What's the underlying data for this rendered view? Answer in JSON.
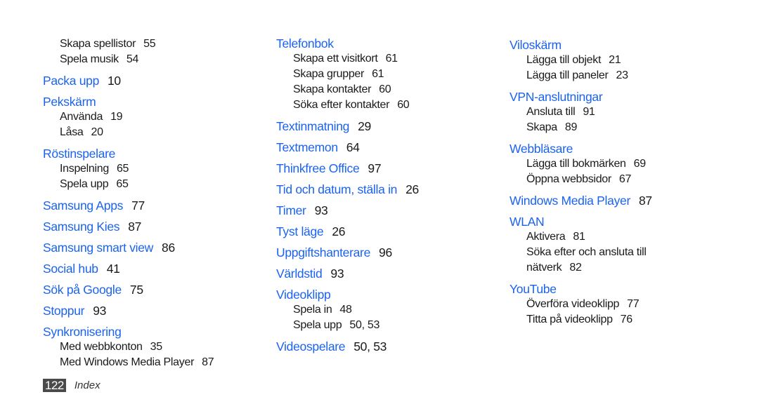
{
  "colors": {
    "heading": "#1b63ef",
    "text": "#1a1a1a",
    "page_badge_bg": "#4a4a4a"
  },
  "columns": [
    {
      "continued_subs": [
        {
          "label": "Skapa spellistor",
          "page": "55"
        },
        {
          "label": "Spela musik",
          "page": "54"
        }
      ],
      "entries": [
        {
          "title": "Packa upp",
          "page": "10",
          "subs": []
        },
        {
          "title": "Pekskärm",
          "page": "",
          "subs": [
            {
              "label": "Använda",
              "page": "19"
            },
            {
              "label": "Låsa",
              "page": "20"
            }
          ]
        },
        {
          "title": "Röstinspelare",
          "page": "",
          "subs": [
            {
              "label": "Inspelning",
              "page": "65"
            },
            {
              "label": "Spela upp",
              "page": "65"
            }
          ]
        },
        {
          "title": "Samsung Apps",
          "page": "77",
          "subs": []
        },
        {
          "title": "Samsung Kies",
          "page": "87",
          "subs": []
        },
        {
          "title": "Samsung smart view",
          "page": "86",
          "subs": []
        },
        {
          "title": "Social hub",
          "page": "41",
          "subs": []
        },
        {
          "title": "Sök på Google",
          "page": "75",
          "subs": []
        },
        {
          "title": "Stoppur",
          "page": "93",
          "subs": []
        },
        {
          "title": "Synkronisering",
          "page": "",
          "subs": [
            {
              "label": "Med webbkonton",
              "page": "35"
            },
            {
              "label": "Med Windows Media Player",
              "page": "87"
            }
          ]
        }
      ]
    },
    {
      "continued_subs": [],
      "entries": [
        {
          "title": "Telefonbok",
          "page": "",
          "subs": [
            {
              "label": "Skapa ett visitkort",
              "page": "61"
            },
            {
              "label": "Skapa grupper",
              "page": "61"
            },
            {
              "label": "Skapa kontakter",
              "page": "60"
            },
            {
              "label": "Söka efter kontakter",
              "page": "60"
            }
          ]
        },
        {
          "title": "Textinmatning",
          "page": "29",
          "subs": []
        },
        {
          "title": "Textmemon",
          "page": "64",
          "subs": []
        },
        {
          "title": "Thinkfree Office",
          "page": "97",
          "subs": []
        },
        {
          "title": "Tid och datum, ställa in",
          "page": "26",
          "subs": []
        },
        {
          "title": "Timer",
          "page": "93",
          "subs": []
        },
        {
          "title": "Tyst läge",
          "page": "26",
          "subs": []
        },
        {
          "title": "Uppgiftshanterare",
          "page": "96",
          "subs": []
        },
        {
          "title": "Världstid",
          "page": "93",
          "subs": []
        },
        {
          "title": "Videoklipp",
          "page": "",
          "subs": [
            {
              "label": "Spela in",
              "page": "48"
            },
            {
              "label": "Spela upp",
              "page": "50, 53"
            }
          ]
        },
        {
          "title": "Videospelare",
          "page": "50, 53",
          "subs": []
        }
      ]
    },
    {
      "continued_subs": [],
      "entries": [
        {
          "title": "Viloskärm",
          "page": "",
          "subs": [
            {
              "label": "Lägga till objekt",
              "page": "21"
            },
            {
              "label": "Lägga till paneler",
              "page": "23"
            }
          ]
        },
        {
          "title": "VPN-anslutningar",
          "page": "",
          "subs": [
            {
              "label": "Ansluta till",
              "page": "91"
            },
            {
              "label": "Skapa",
              "page": "89"
            }
          ]
        },
        {
          "title": "Webbläsare",
          "page": "",
          "subs": [
            {
              "label": "Lägga till bokmärken",
              "page": "69"
            },
            {
              "label": "Öppna webbsidor",
              "page": "67"
            }
          ]
        },
        {
          "title": "Windows Media Player",
          "page": "87",
          "subs": []
        },
        {
          "title": "WLAN",
          "page": "",
          "subs": [
            {
              "label": "Aktivera",
              "page": "81"
            },
            {
              "label": "Söka efter och ansluta till nätverk",
              "page": "82",
              "wrap": true
            }
          ]
        },
        {
          "title": "YouTube",
          "page": "",
          "subs": [
            {
              "label": "Överföra videoklipp",
              "page": "77"
            },
            {
              "label": "Titta på videoklipp",
              "page": "76"
            }
          ]
        }
      ]
    }
  ],
  "footer": {
    "page_number": "122",
    "section": "Index"
  }
}
